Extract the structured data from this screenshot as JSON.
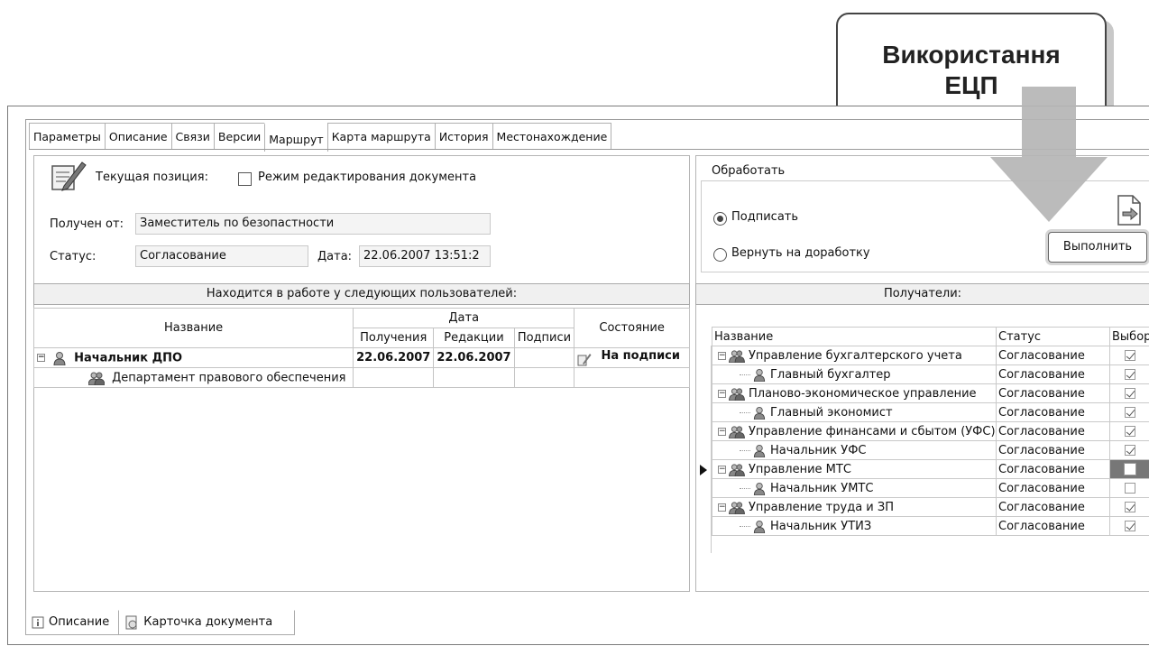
{
  "callout": {
    "line1": "Використання",
    "line2": "ЕЦП"
  },
  "tabs": [
    "Параметры",
    "Описание",
    "Связи",
    "Версии",
    "Маршрут",
    "Карта маршрута",
    "История",
    "Местонахождение"
  ],
  "active_tab_index": 4,
  "left": {
    "current_position_label": "Текущая позиция:",
    "edit_mode_label": "Режим редактирования документа",
    "edit_mode_checked": false,
    "received_from_label": "Получен от:",
    "received_from_value": "Заместитель по безопастности",
    "status_label": "Статус:",
    "status_value": "Согласование",
    "date_label": "Дата:",
    "date_value": "22.06.2007 13:51:2",
    "users_header": "Находится в работе у следующих пользователей:",
    "col_name": "Название",
    "col_date": "Дата",
    "col_received": "Получения",
    "col_edited": "Редакции",
    "col_signed": "Подписи",
    "col_state": "Состояние",
    "rows": [
      {
        "name": "Начальник ДПО",
        "received": "22.06.2007",
        "edited": "22.06.2007",
        "signed": "",
        "state": "На подписи"
      },
      {
        "name": "Департамент правового обеспечения",
        "received": "",
        "edited": "",
        "signed": "",
        "state": ""
      }
    ]
  },
  "right": {
    "process_group": "Обработать",
    "option_sign": "Подписать",
    "option_return": "Вернуть на доработку",
    "selected_option": "sign",
    "execute_button": "Выполнить",
    "recipients_header": "Получатели:",
    "col_name": "Название",
    "col_status": "Статус",
    "col_select": "Выбор",
    "rows": [
      {
        "name": "Управление бухгалтерского учета",
        "status": "Согласование",
        "checked": true,
        "level": 0,
        "icon": "group-icon"
      },
      {
        "name": "Главный бухгалтер",
        "status": "Согласование",
        "checked": true,
        "level": 1,
        "icon": "user-icon"
      },
      {
        "name": "Планово-экономическое управление",
        "status": "Согласование",
        "checked": true,
        "level": 0,
        "icon": "group-icon"
      },
      {
        "name": "Главный экономист",
        "status": "Согласование",
        "checked": true,
        "level": 1,
        "icon": "user-icon"
      },
      {
        "name": "Управление финансами и сбытом (УФС)",
        "status": "Согласование",
        "checked": true,
        "level": 0,
        "icon": "group-icon"
      },
      {
        "name": "Начальник УФС",
        "status": "Согласование",
        "checked": true,
        "level": 1,
        "icon": "user-icon"
      },
      {
        "name": "Управление МТС",
        "status": "Согласование",
        "checked": false,
        "level": 0,
        "icon": "group-icon",
        "current": true
      },
      {
        "name": "Начальник УМТС",
        "status": "Согласование",
        "checked": false,
        "level": 1,
        "icon": "user-icon"
      },
      {
        "name": "Управление труда и ЗП",
        "status": "Согласование",
        "checked": true,
        "level": 0,
        "icon": "group-icon"
      },
      {
        "name": "Начальник УТИЗ",
        "status": "Согласование",
        "checked": true,
        "level": 1,
        "icon": "user-icon"
      }
    ]
  },
  "bottom_tabs": [
    "Описание",
    "Карточка документа"
  ]
}
